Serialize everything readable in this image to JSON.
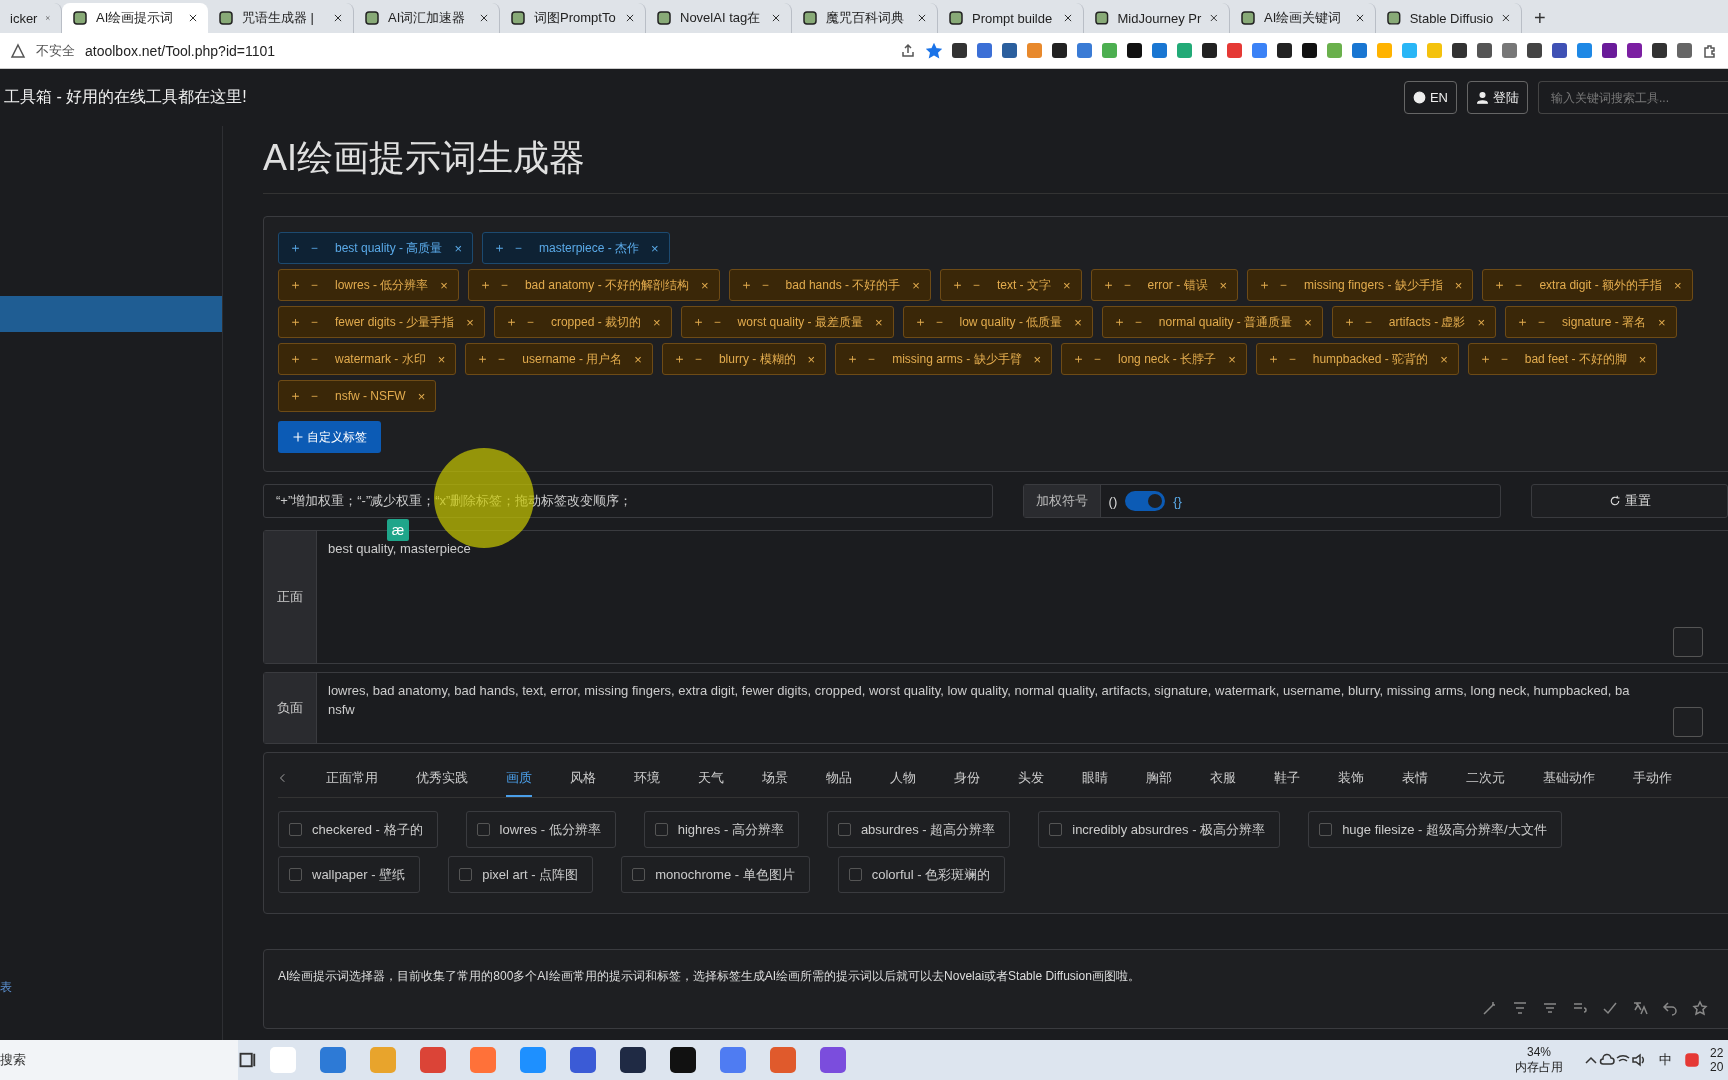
{
  "browser": {
    "tabs": [
      {
        "title": "icker",
        "selected": false
      },
      {
        "title": "AI绘画提示词",
        "selected": true
      },
      {
        "title": "咒语生成器 |",
        "selected": false
      },
      {
        "title": "AI词汇加速器",
        "selected": false
      },
      {
        "title": "词图PromptTo",
        "selected": false
      },
      {
        "title": "NovelAI tag在",
        "selected": false
      },
      {
        "title": "魔咒百科词典",
        "selected": false
      },
      {
        "title": "Prompt builde",
        "selected": false
      },
      {
        "title": "MidJourney Pr",
        "selected": false
      },
      {
        "title": "AI绘画关键词",
        "selected": false
      },
      {
        "title": "Stable Diffusio",
        "selected": false
      }
    ],
    "new_tab": "+",
    "security": "不安全",
    "url": "atoolbox.net/Tool.php?id=1101"
  },
  "header": {
    "title": "工具箱 - 好用的在线工具都在这里!",
    "lang_button": "EN",
    "login_button": "登陆",
    "search_placeholder": "输入关键词搜索工具..."
  },
  "sidebar": {
    "items": [
      {
        "selected": true
      }
    ],
    "footer_text": "表"
  },
  "page_title": "AI绘画提示词生成器",
  "tag_rows": [
    [
      {
        "kind": "positive",
        "label": "best quality - 高质量"
      },
      {
        "kind": "positive",
        "label": "masterpiece - 杰作"
      }
    ],
    [
      {
        "kind": "negative",
        "label": "lowres - 低分辨率"
      },
      {
        "kind": "negative",
        "label": "bad anatomy - 不好的解剖结构"
      },
      {
        "kind": "negative",
        "label": "bad hands - 不好的手"
      },
      {
        "kind": "negative",
        "label": "text - 文字"
      },
      {
        "kind": "negative",
        "label": "error - 错误"
      },
      {
        "kind": "negative",
        "label": "missing fingers - 缺少手指"
      },
      {
        "kind": "negative",
        "label": "extra digit - 额外的手指"
      }
    ],
    [
      {
        "kind": "negative",
        "label": "fewer digits - 少量手指"
      },
      {
        "kind": "negative",
        "label": "cropped - 裁切的"
      },
      {
        "kind": "negative",
        "label": "worst quality - 最差质量"
      },
      {
        "kind": "negative",
        "label": "low quality - 低质量"
      },
      {
        "kind": "negative",
        "label": "normal quality - 普通质量"
      },
      {
        "kind": "negative",
        "label": "artifacts - 虚影"
      },
      {
        "kind": "negative",
        "label": "signature - 署名"
      }
    ],
    [
      {
        "kind": "negative",
        "label": "watermark - 水印"
      },
      {
        "kind": "negative",
        "label": "username - 用户名"
      },
      {
        "kind": "negative",
        "label": "blurry - 模糊的"
      },
      {
        "kind": "negative",
        "label": "missing arms - 缺少手臂"
      },
      {
        "kind": "negative",
        "label": "long neck - 长脖子"
      },
      {
        "kind": "negative",
        "label": "humpbacked - 驼背的"
      },
      {
        "kind": "negative",
        "label": "bad feet - 不好的脚"
      }
    ],
    [
      {
        "kind": "negative",
        "label": "nsfw - NSFW"
      }
    ]
  ],
  "tag_controls": {
    "plus": "＋",
    "minus": "－",
    "remove": "×"
  },
  "custom_tag_button": "自定义标签",
  "hint": "“+”增加权重；“-”减少权重；“x”删除标签；拖动标签改变顺序；",
  "popup_badge": "æ",
  "weight": {
    "label": "加权符号",
    "left": "()",
    "right": "{}",
    "on": true
  },
  "reset_button": "重置",
  "prompts": [
    {
      "label": "正面",
      "lines": [
        "best quality, masterpiece"
      ]
    },
    {
      "label": "负面",
      "lines": [
        "lowres, bad anatomy, bad hands, text, error, missing fingers, extra digit, fewer digits, cropped, worst quality, low quality, normal quality, artifacts, signature, watermark, username, blurry, missing arms, long neck, humpbacked, ba",
        "nsfw"
      ]
    }
  ],
  "categories": [
    {
      "label": "正面常用",
      "selected": false
    },
    {
      "label": "优秀实践",
      "selected": false
    },
    {
      "label": "画质",
      "selected": true
    },
    {
      "label": "风格",
      "selected": false
    },
    {
      "label": "环境",
      "selected": false
    },
    {
      "label": "天气",
      "selected": false
    },
    {
      "label": "场景",
      "selected": false
    },
    {
      "label": "物品",
      "selected": false
    },
    {
      "label": "人物",
      "selected": false
    },
    {
      "label": "身份",
      "selected": false
    },
    {
      "label": "头发",
      "selected": false
    },
    {
      "label": "眼睛",
      "selected": false
    },
    {
      "label": "胸部",
      "selected": false
    },
    {
      "label": "衣服",
      "selected": false
    },
    {
      "label": "鞋子",
      "selected": false
    },
    {
      "label": "装饰",
      "selected": false
    },
    {
      "label": "表情",
      "selected": false
    },
    {
      "label": "二次元",
      "selected": false
    },
    {
      "label": "基础动作",
      "selected": false
    },
    {
      "label": "手动作",
      "selected": false
    }
  ],
  "option_rows": [
    [
      {
        "label": "checkered - 格子的",
        "checked": false
      },
      {
        "label": "lowres - 低分辨率",
        "checked": false
      },
      {
        "label": "highres - 高分辨率",
        "checked": false
      },
      {
        "label": "absurdres - 超高分辨率",
        "checked": false
      },
      {
        "label": "incredibly absurdres - 极高分辨率",
        "checked": false
      },
      {
        "label": "huge filesize - 超级高分辨率/大文件",
        "checked": false
      }
    ],
    [
      {
        "label": "wallpaper - 壁纸",
        "checked": false
      },
      {
        "label": "pixel art - 点阵图",
        "checked": false
      },
      {
        "label": "monochrome - 单色图片",
        "checked": false
      },
      {
        "label": "colorful - 色彩斑斓的",
        "checked": false
      }
    ]
  ],
  "description": "AI绘画提示词选择器，目前收集了常用的800多个AI绘画常用的提示词和标签，选择标签生成AI绘画所需的提示词以后就可以去Novelai或者Stable Diffusion画图啦。",
  "taskbar": {
    "search": "搜索",
    "memory_percent": "34%",
    "memory_label": "内存占用",
    "ime": "中",
    "time": "22",
    "date": "20"
  }
}
